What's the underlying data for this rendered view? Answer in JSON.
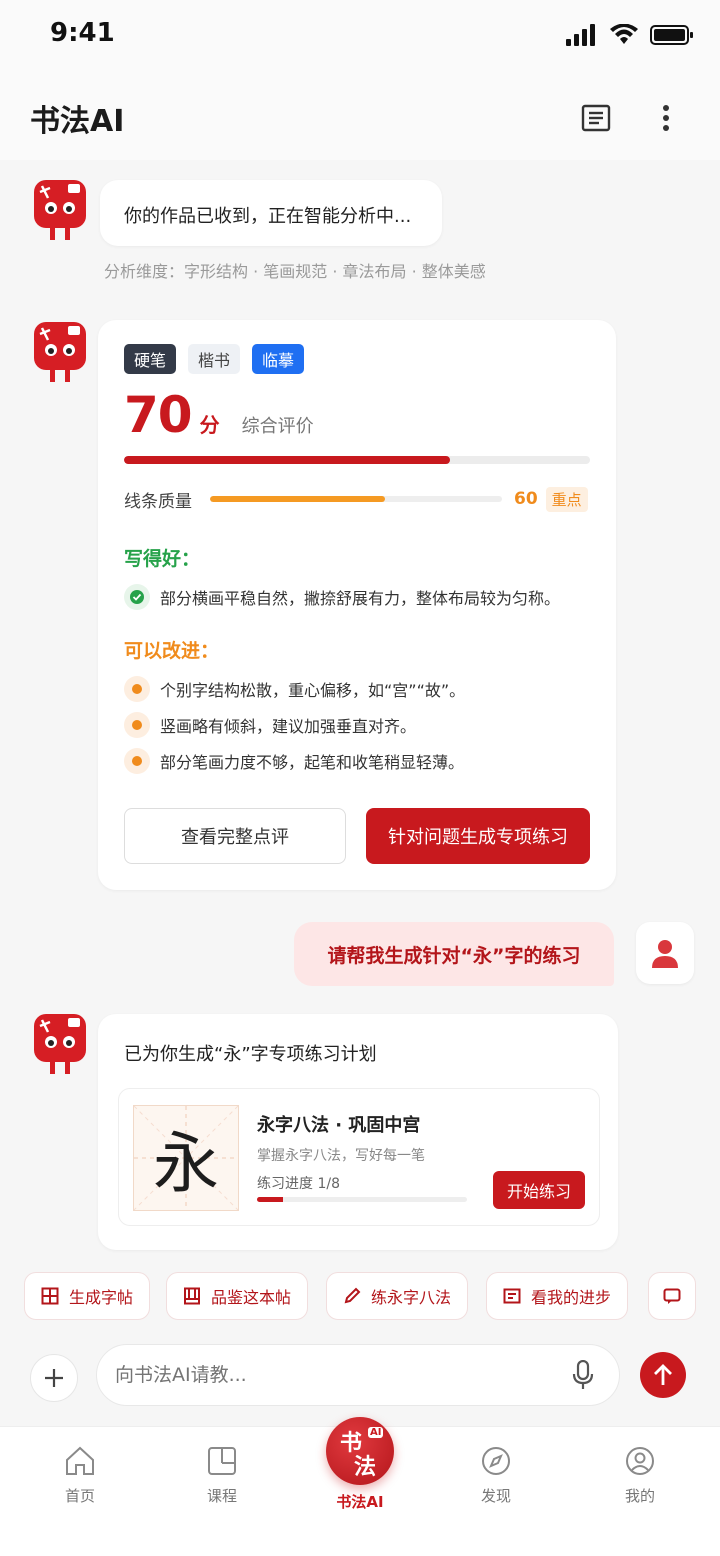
{
  "status": {
    "time": "9:41"
  },
  "header": {
    "title": "书法AI"
  },
  "chat": {
    "msg1": "你的作品已收到，正在智能分析中...",
    "dims": "分析维度：字形结构 · 笔画规范 · 章法布局 · 整体美感",
    "card": {
      "tags": [
        "硬笔",
        "楷书",
        "临摹"
      ],
      "score": "70",
      "score_unit": "分",
      "score_label": "综合评价",
      "score_fraction": 0.7,
      "metric": {
        "name": "线条质量",
        "value": "60",
        "fraction": 0.6,
        "badge": "重点"
      },
      "good_title": "写得好：",
      "good_items": [
        "部分横画平稳自然，撇捺舒展有力，整体布局较为匀称。"
      ],
      "improve_title": "可以改进：",
      "improve_items": [
        "个别字结构松散，重心偏移，如“宫”“故”。",
        "竖画略有倾斜，建议加强垂直对齐。",
        "部分笔画力度不够，起笔和收笔稍显轻薄。"
      ],
      "btn_full": "查看完整点评",
      "btn_practice": "针对问题生成专项练习"
    },
    "user_msg": "请帮我生成针对“永”字的练习",
    "plan": {
      "title": "已为你生成“永”字专项练习计划",
      "glyph": "永",
      "name": "永字八法 · 巩固中宫",
      "sub": "掌握永字八法，写好每一笔",
      "progress_label": "练习进度  1/8",
      "progress_fraction": 0.125,
      "start": "开始练习"
    }
  },
  "chips": [
    "生成字帖",
    "品鉴这本帖",
    "练永字八法",
    "看我的进步"
  ],
  "composer": {
    "placeholder": "向书法AI请教..."
  },
  "tabs": {
    "home": "首页",
    "course": "课程",
    "ai": "书法AI",
    "discover": "发现",
    "mine": "我的"
  },
  "logo": {
    "text1": "书",
    "text2": "法",
    "badge": "AI"
  },
  "colors": {
    "brand": "#c8191e",
    "good": "#26a24a",
    "warn": "#f08b1c",
    "blue": "#1f6ff2"
  }
}
